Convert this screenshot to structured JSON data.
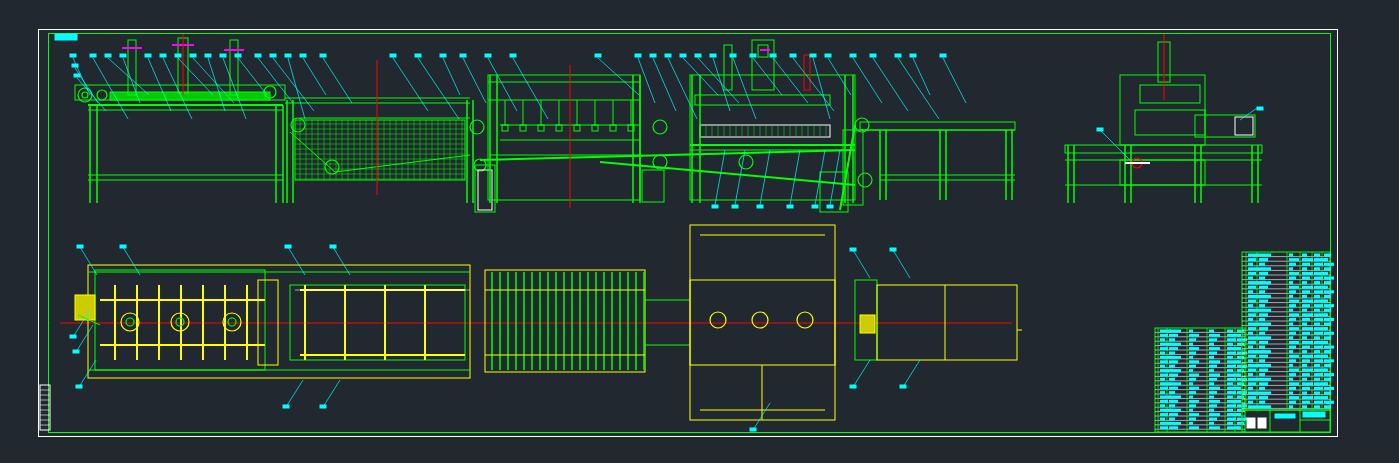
{
  "sheet": {
    "views": [
      {
        "kind": "front_elevation"
      },
      {
        "kind": "side_elevation"
      },
      {
        "kind": "plan"
      },
      {
        "kind": "parts_list"
      },
      {
        "kind": "title_block"
      }
    ]
  }
}
